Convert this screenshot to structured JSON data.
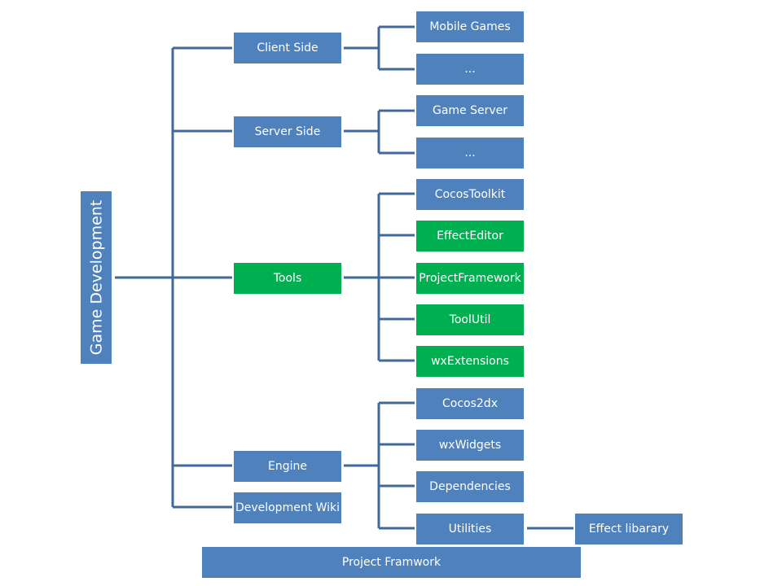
{
  "diagram": {
    "root": {
      "label": "Game Development"
    },
    "colors": {
      "blue": "#4f81bd",
      "green": "#00b050",
      "connector": "#41689a"
    },
    "categories": [
      {
        "label": "Client Side",
        "color": "blue",
        "children": [
          {
            "label": "Mobile Games",
            "color": "blue"
          },
          {
            "label": "...",
            "color": "blue"
          }
        ]
      },
      {
        "label": "Server Side",
        "color": "blue",
        "children": [
          {
            "label": "Game Server",
            "color": "blue"
          },
          {
            "label": "...",
            "color": "blue"
          }
        ]
      },
      {
        "label": "Tools",
        "color": "green",
        "children": [
          {
            "label": "CocosToolkit",
            "color": "blue"
          },
          {
            "label": "EffectEditor",
            "color": "green"
          },
          {
            "label": "ProjectFramework",
            "color": "green"
          },
          {
            "label": "ToolUtil",
            "color": "green"
          },
          {
            "label": "wxExtensions",
            "color": "green"
          }
        ]
      },
      {
        "label": "Engine",
        "color": "blue",
        "children": [
          {
            "label": "Cocos2dx",
            "color": "blue"
          },
          {
            "label": "wxWidgets",
            "color": "blue"
          },
          {
            "label": "Dependencies",
            "color": "blue"
          },
          {
            "label": "Utilities",
            "color": "blue",
            "children": [
              {
                "label": "Effect libarary",
                "color": "blue"
              }
            ]
          }
        ]
      },
      {
        "label": "Development Wiki",
        "color": "blue"
      }
    ],
    "footer": {
      "label": "Project Framwork"
    }
  }
}
